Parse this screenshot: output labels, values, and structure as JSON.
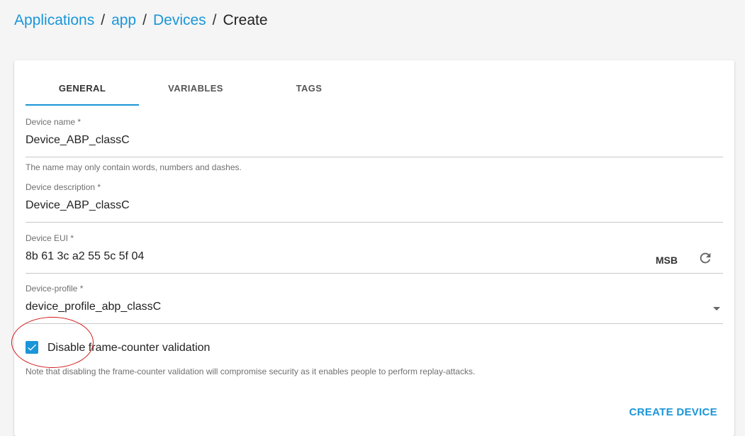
{
  "breadcrumb": {
    "items": [
      "Applications",
      "app",
      "Devices"
    ],
    "separator": "/",
    "current": "Create"
  },
  "tabs": [
    {
      "label": "GENERAL",
      "active": true
    },
    {
      "label": "VARIABLES",
      "active": false
    },
    {
      "label": "TAGS",
      "active": false
    }
  ],
  "form": {
    "device_name": {
      "label": "Device name *",
      "value": "Device_ABP_classC",
      "helper": "The name may only contain words, numbers and dashes."
    },
    "device_description": {
      "label": "Device description *",
      "value": "Device_ABP_classC"
    },
    "device_eui": {
      "label": "Device EUI *",
      "value": "8b 61 3c a2 55 5c 5f 04",
      "byte_order": "MSB",
      "refresh_icon": "refresh-icon"
    },
    "device_profile": {
      "label": "Device-profile *",
      "value": "device_profile_abp_classC",
      "dropdown_icon": "chevron-down-icon"
    },
    "frame_counter": {
      "label": "Disable frame-counter validation",
      "checked": true,
      "note": "Note that disabling the frame-counter validation will compromise security as it enables people to perform replay-attacks."
    }
  },
  "actions": {
    "create_label": "CREATE DEVICE"
  },
  "colors": {
    "accent": "#1a96d8",
    "annotation": "#d01818",
    "background": "#f5f5f5"
  }
}
